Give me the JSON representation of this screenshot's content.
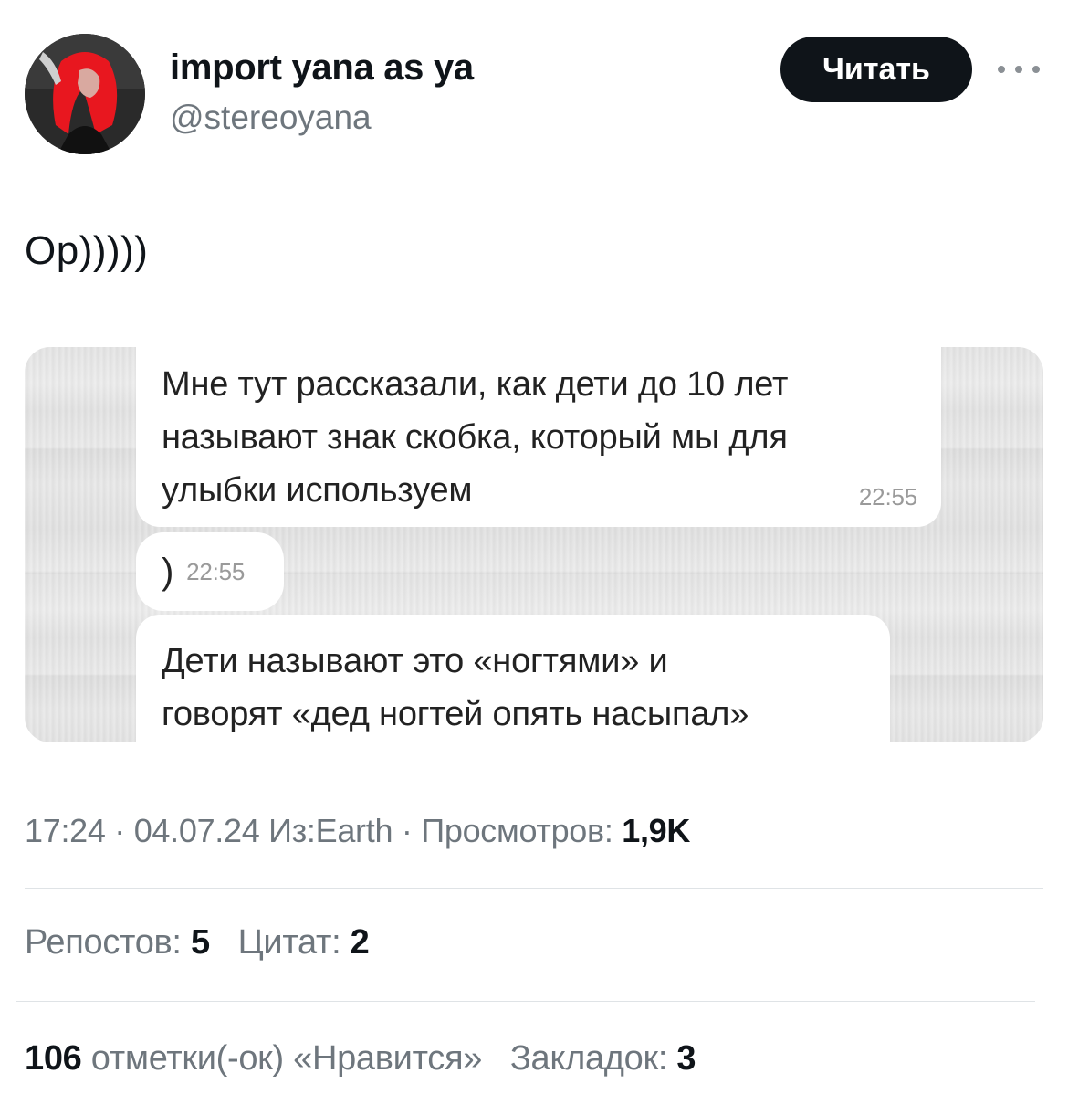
{
  "author": {
    "display_name": "import yana as ya",
    "handle": "@stereoyana",
    "follow_label": "Читать"
  },
  "tweet": {
    "text": "Ор)))))"
  },
  "media": {
    "messages": [
      {
        "lines": [
          "Мне тут рассказали, как дети до 10 лет",
          "называют знак скобка, который мы для",
          "улыбки используем"
        ],
        "time": "22:55"
      },
      {
        "lines": [
          ")"
        ],
        "time": "22:55"
      },
      {
        "lines": [
          "Дети называют это «ногтями» и",
          "говорят «дед ногтей опять насыпал»"
        ]
      }
    ]
  },
  "meta": {
    "time": "17:24",
    "separator": "·",
    "date": "04.07.24",
    "source": "Из:Earth",
    "views_label": "Просмотров:",
    "views_value": "1,9K"
  },
  "stats": {
    "reposts_label": "Репостов:",
    "reposts_value": "5",
    "quotes_label": "Цитат:",
    "quotes_value": "2",
    "likes_value": "106",
    "likes_label": "отметки(-ок) «Нравится»",
    "bookmarks_label": "Закладок:",
    "bookmarks_value": "3"
  }
}
